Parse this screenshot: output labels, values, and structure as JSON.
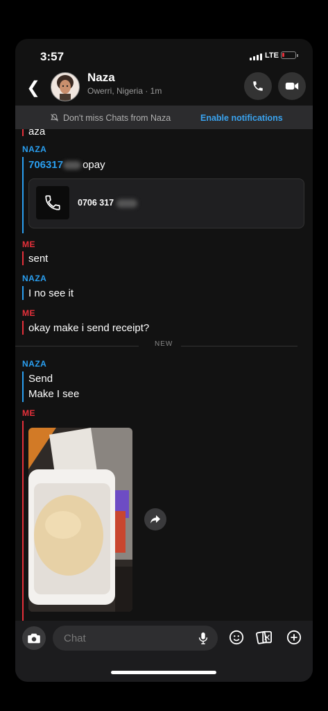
{
  "status": {
    "time": "3:57",
    "network": "LTE"
  },
  "header": {
    "name": "Naza",
    "subtitle": "Owerri, Nigeria · 1m"
  },
  "banner": {
    "text": "Don't miss Chats from Naza",
    "action": "Enable notifications"
  },
  "chat": {
    "partial_top": "aza",
    "sender_naza": "NAZA",
    "sender_me": "ME",
    "phone_message": {
      "number_visible": "706317",
      "suffix": "opay"
    },
    "contact_card_number": "0706 317",
    "msg_sent": "sent",
    "msg_no_see": "I no see it",
    "msg_receipt": "okay make i send receipt?",
    "new_divider": "NEW",
    "msg_send": "Send",
    "msg_make_see": "Make I see"
  },
  "composer": {
    "placeholder": "Chat"
  },
  "colors": {
    "me": "#e5303a",
    "naza": "#2a9ff0",
    "link": "#3aa3ef",
    "background": "#121212"
  }
}
